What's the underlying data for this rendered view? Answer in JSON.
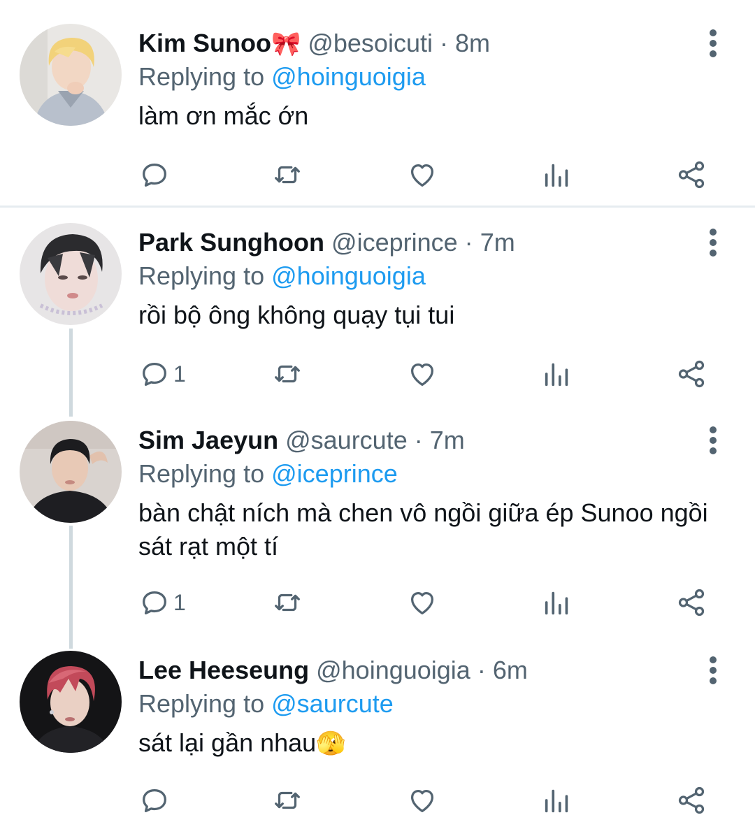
{
  "tweets": [
    {
      "name": "Kim Sunoo",
      "name_emoji": "🎀",
      "handle": "@besoicuti",
      "dot": "·",
      "time": "8m",
      "replying_prefix": "Replying to",
      "replying_to": "@hoinguoigia",
      "text": "làm ơn mắc ớn",
      "reply_count": ""
    },
    {
      "name": "Park Sunghoon",
      "name_emoji": "",
      "handle": "@iceprince",
      "dot": "·",
      "time": "7m",
      "replying_prefix": "Replying to",
      "replying_to": "@hoinguoigia",
      "text": "rồi bộ ông không quạy tụi tui",
      "reply_count": "1"
    },
    {
      "name": "Sim Jaeyun",
      "name_emoji": "",
      "handle": "@saurcute",
      "dot": "·",
      "time": "7m",
      "replying_prefix": "Replying to",
      "replying_to": "@iceprince",
      "text": "bàn chật ních mà chen vô ngồi giữa ép Sunoo ngồi sát rạt một tí",
      "reply_count": "1"
    },
    {
      "name": "Lee Heeseung",
      "name_emoji": "",
      "handle": "@hoinguoigia",
      "dot": "·",
      "time": "6m",
      "replying_prefix": "Replying to",
      "replying_to": "@saurcute",
      "text": "sát lại gần nhau",
      "text_emoji": "🫣",
      "reply_count": ""
    }
  ],
  "icons": {
    "reply": "reply-icon",
    "retweet": "retweet-icon",
    "like": "heart-icon",
    "views": "analytics-icon",
    "share": "share-icon",
    "more": "more-vertical-icon"
  },
  "colors": {
    "accent": "#1d9bf0",
    "secondary_text": "#536471",
    "primary_text": "#0f1419",
    "thread_line": "#cfd9de",
    "divider": "#e6ecf0"
  }
}
